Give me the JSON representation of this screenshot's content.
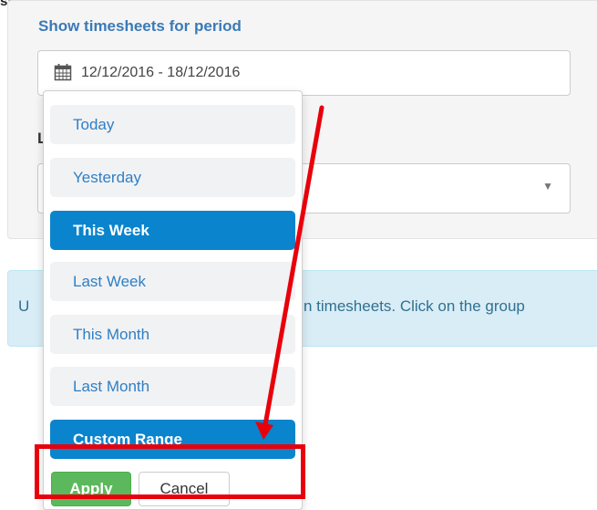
{
  "header": {
    "title_fragment": "st."
  },
  "filter": {
    "period_label": "Show timesheets for period",
    "period_value": "12/12/2016 - 18/12/2016",
    "second_label_visible": "L",
    "select_caret": "▼"
  },
  "info": {
    "prefix": "U",
    "text": "n timesheets. Click on the group"
  },
  "date_range_menu": {
    "items": [
      {
        "label": "Today",
        "active": false
      },
      {
        "label": "Yesterday",
        "active": false
      },
      {
        "label": "This Week",
        "active": true
      },
      {
        "label": "Last Week",
        "active": false
      },
      {
        "label": "This Month",
        "active": false
      },
      {
        "label": "Last Month",
        "active": false
      },
      {
        "label": "Custom Range",
        "active": true
      }
    ],
    "apply_label": "Apply",
    "cancel_label": "Cancel"
  },
  "annotation": {
    "color": "#e8000b"
  },
  "colors": {
    "link": "#2f7fc5",
    "active": "#0a84cc",
    "apply": "#5cb85c",
    "info_bg": "#d9edf7"
  },
  "icons": {
    "calendar": "calendar-icon",
    "caret": "caret-down-icon"
  }
}
